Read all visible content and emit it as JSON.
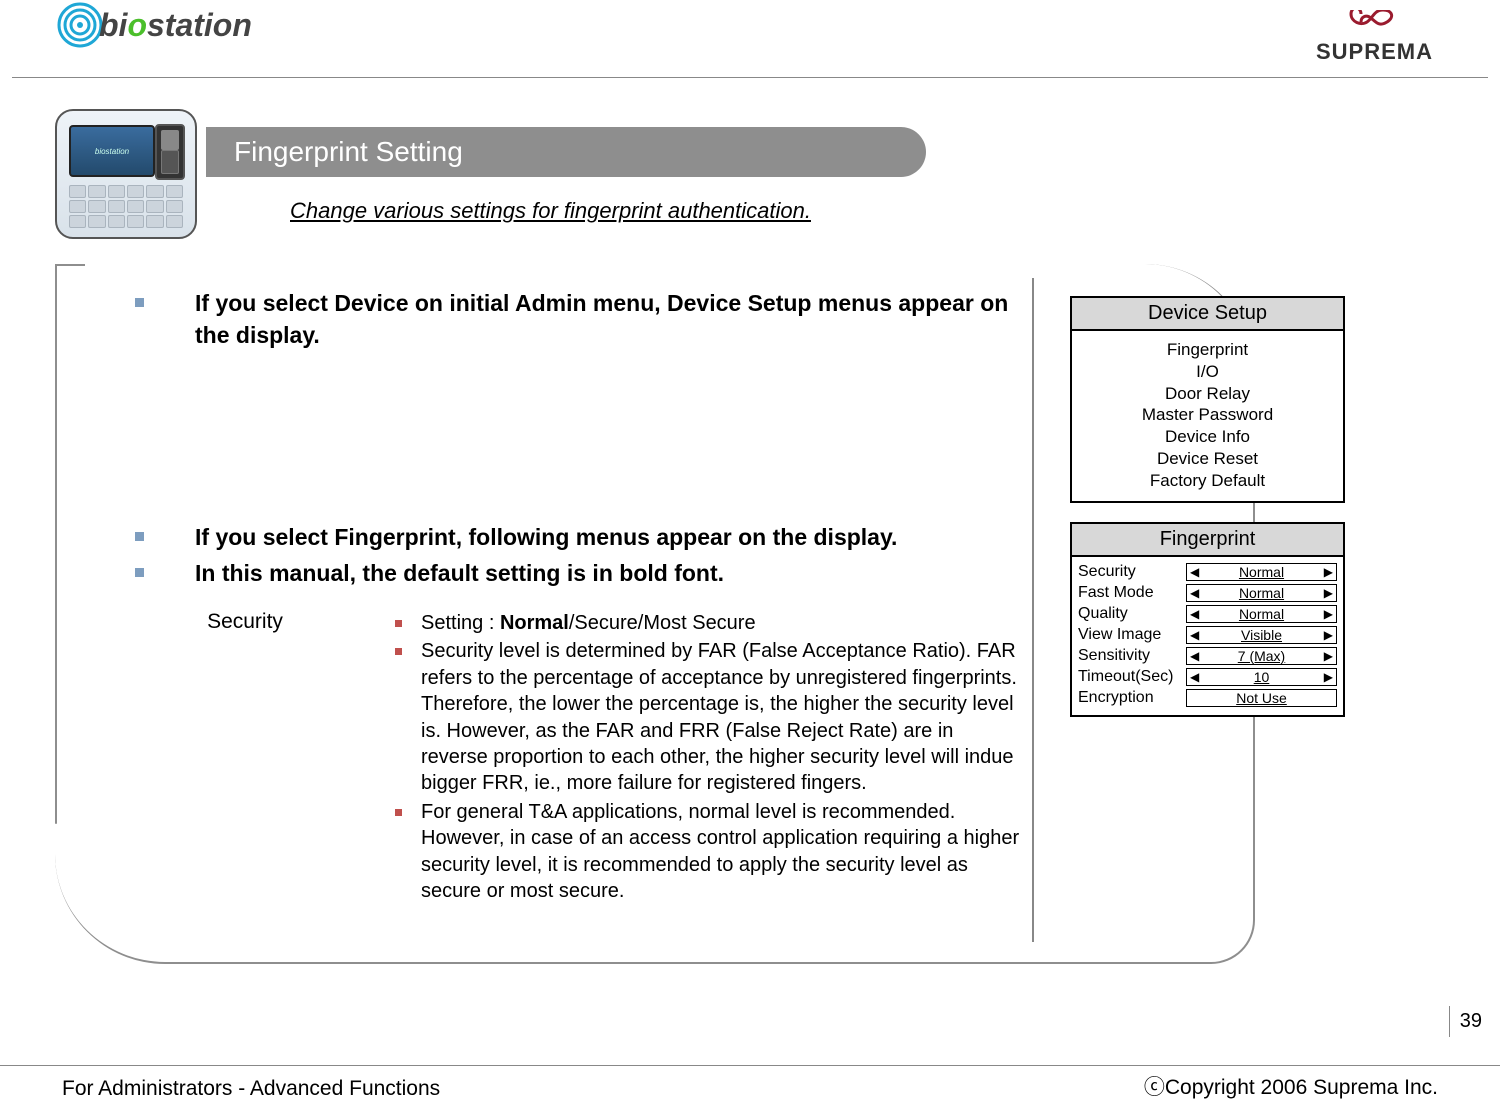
{
  "logos": {
    "biostation": {
      "prefix": "bi",
      "green": "o",
      "suffix": "station"
    },
    "suprema": "SUPREMA"
  },
  "title": "Fingerprint Setting",
  "subtitle": "Change various settings for fingerprint authentication.",
  "mainPoints": {
    "p1": "If you select Device on initial Admin menu, Device Setup menus appear on the display.",
    "p2": "If you select Fingerprint, following menus appear on the display.",
    "p3": "In this manual, the default setting is in bold font."
  },
  "security": {
    "label": "Security",
    "items": [
      {
        "prefix": "Setting : ",
        "bold": "Normal",
        "suffix": "/Secure/Most Secure"
      },
      {
        "text": "Security level is determined by FAR (False Acceptance Ratio). FAR refers to the percentage of acceptance by unregistered fingerprints. Therefore, the lower the percentage is, the higher the security level is. However, as the FAR and FRR (False Reject Rate) are in reverse proportion to each other, the higher security level will indue bigger FRR, ie., more failure for registered fingers."
      },
      {
        "text": "For general T&A applications, normal level is recommended. However, in case of an access control application requiring a higher security level, it is recommended to apply the security level as secure or most secure."
      }
    ]
  },
  "deviceSetup": {
    "title": "Device Setup",
    "items": [
      "Fingerprint",
      "I/O",
      "Door Relay",
      "Master Password",
      "Device Info",
      "Device Reset",
      "Factory Default"
    ]
  },
  "fingerprint": {
    "title": "Fingerprint",
    "rows": [
      {
        "label": "Security",
        "value": "Normal",
        "arrows": true
      },
      {
        "label": "Fast Mode",
        "value": "Normal",
        "arrows": true
      },
      {
        "label": "Quality",
        "value": "Normal",
        "arrows": true
      },
      {
        "label": "View Image",
        "value": "Visible",
        "arrows": true
      },
      {
        "label": "Sensitivity",
        "value": "7 (Max)",
        "arrows": true
      },
      {
        "label": "Timeout(Sec)",
        "value": "10",
        "arrows": true
      },
      {
        "label": "Encryption",
        "value": "Not Use",
        "arrows": false
      }
    ]
  },
  "page": "39",
  "footer": {
    "left": "For Administrators - Advanced Functions",
    "right": "ⓒCopyright 2006 Suprema Inc."
  }
}
